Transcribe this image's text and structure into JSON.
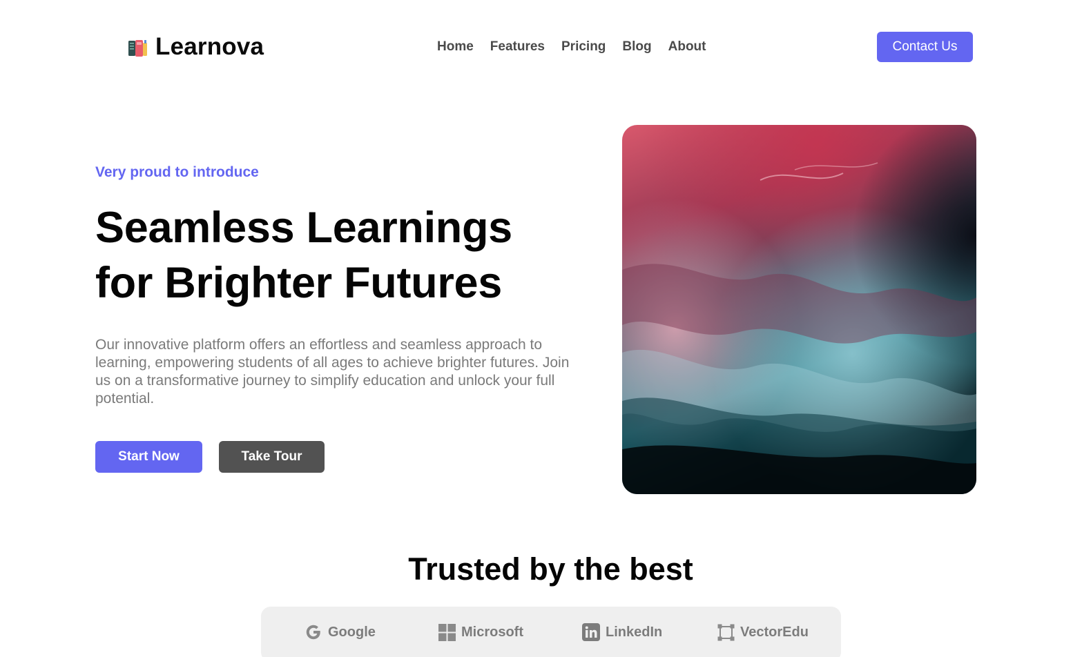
{
  "header": {
    "brand_name": "Learnova",
    "logo_icon": "book-icon",
    "nav": [
      "Home",
      "Features",
      "Pricing",
      "Blog",
      "About"
    ],
    "contact_label": "Contact Us"
  },
  "hero": {
    "eyebrow": "Very proud to introduce",
    "title_line1": "Seamless Learnings",
    "title_line2": "for Brighter Futures",
    "description": "Our innovative platform offers an effortless and seamless approach to learning, empowering students of all ages to achieve brighter futures. Join us on a transformative journey to simplify education and unlock your full potential.",
    "primary_cta": "Start Now",
    "secondary_cta": "Take Tour"
  },
  "trusted": {
    "title": "Trusted by the best",
    "brands": [
      {
        "name": "Google",
        "icon": "google-icon"
      },
      {
        "name": "Microsoft",
        "icon": "microsoft-icon"
      },
      {
        "name": "LinkedIn",
        "icon": "linkedin-icon"
      },
      {
        "name": "VectorEdu",
        "icon": "vector-icon"
      }
    ]
  },
  "colors": {
    "accent": "#6366f1",
    "secondary_button": "#525252",
    "muted_text": "#7a7a7a",
    "brand_strip": "#efefef"
  }
}
